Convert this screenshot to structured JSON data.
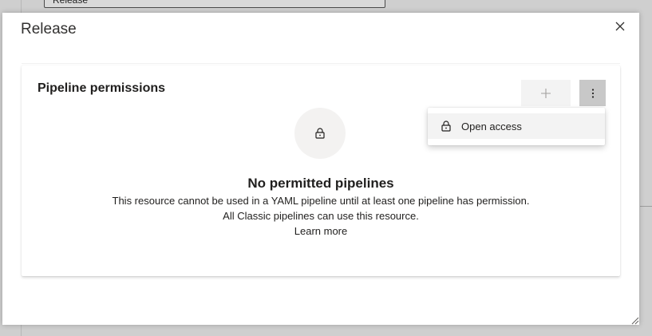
{
  "background": {
    "field_text": "Release"
  },
  "dialog": {
    "title": "Release",
    "close_icon": "close-icon"
  },
  "card": {
    "title": "Pipeline permissions",
    "add_icon": "plus-icon",
    "more_icon": "more-vertical-icon",
    "empty_icon": "lock-icon",
    "empty_title": "No permitted pipelines",
    "empty_line_1": "This resource cannot be used in a YAML pipeline until at least one pipeline has permission.",
    "empty_line_2": "All Classic pipelines can use this resource.",
    "learn_more": "Learn more"
  },
  "context_menu": {
    "items": [
      {
        "label": "Open access",
        "icon": "unlock-icon"
      }
    ]
  },
  "colors": {
    "accent": "#0078d4",
    "text": "#201f1e",
    "button_disabled_bg": "#f3f3f3",
    "button_active_bg": "#c8c8c8"
  }
}
